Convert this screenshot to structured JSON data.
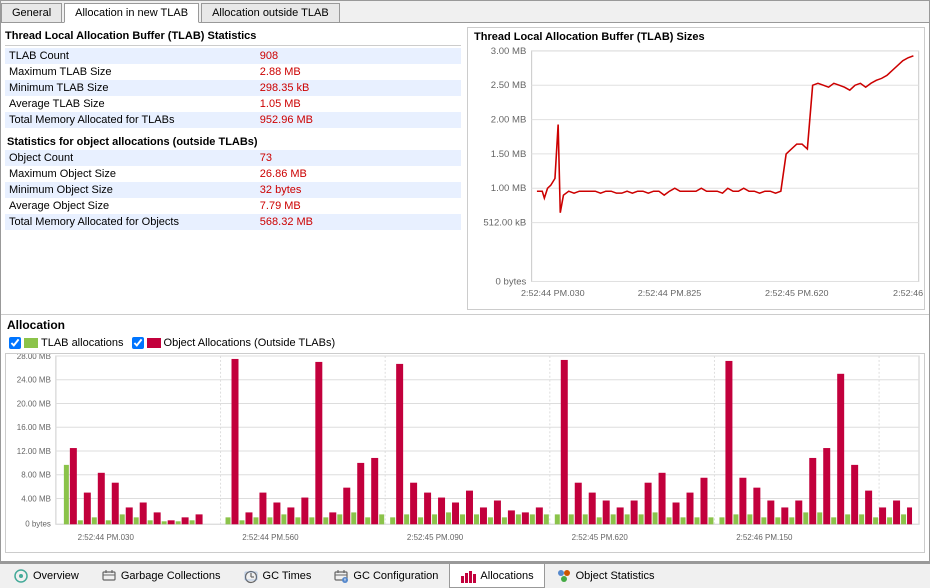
{
  "tabs": {
    "top": [
      {
        "label": "General",
        "active": false
      },
      {
        "label": "Allocation in new TLAB",
        "active": true
      },
      {
        "label": "Allocation outside TLAB",
        "active": false
      }
    ],
    "bottom": [
      {
        "label": "Overview",
        "icon": "overview",
        "active": false
      },
      {
        "label": "Garbage Collections",
        "icon": "gc",
        "active": false
      },
      {
        "label": "GC Times",
        "icon": "gctimes",
        "active": false
      },
      {
        "label": "GC Configuration",
        "icon": "gcconfig",
        "active": false
      },
      {
        "label": "Allocations",
        "icon": "alloc",
        "active": true
      },
      {
        "label": "Object Statistics",
        "icon": "objstats",
        "active": false
      }
    ]
  },
  "tlab_stats": {
    "title": "Thread Local Allocation Buffer (TLAB) Statistics",
    "rows": [
      {
        "label": "TLAB Count",
        "value": "908"
      },
      {
        "label": "Maximum TLAB Size",
        "value": "2.88 MB"
      },
      {
        "label": "Minimum TLAB Size",
        "value": "298.35 kB"
      },
      {
        "label": "Average TLAB Size",
        "value": "1.05 MB"
      },
      {
        "label": "Total Memory Allocated for TLABs",
        "value": "952.96 MB"
      }
    ]
  },
  "outside_stats": {
    "title": "Statistics for object allocations (outside TLABs)",
    "rows": [
      {
        "label": "Object Count",
        "value": "73"
      },
      {
        "label": "Maximum Object Size",
        "value": "26.86 MB"
      },
      {
        "label": "Minimum Object Size",
        "value": "32 bytes"
      },
      {
        "label": "Average Object Size",
        "value": "7.79 MB"
      },
      {
        "label": "Total Memory Allocated for Objects",
        "value": "568.32 MB"
      }
    ]
  },
  "tlab_chart": {
    "title": "Thread Local Allocation Buffer (TLAB) Sizes",
    "y_labels": [
      "3.00 MB",
      "2.50 MB",
      "2.00 MB",
      "1.50 MB",
      "1.00 MB",
      "512.00 kB",
      "0 bytes"
    ],
    "x_labels": [
      "2:52:44 PM.030",
      "2:52:44 PM.825",
      "2:52:45 PM.620",
      "2:52:46"
    ]
  },
  "allocation_section": {
    "title": "Allocation",
    "legend": [
      {
        "label": "TLAB allocations",
        "color": "#8bc34a"
      },
      {
        "label": "Object Allocations (Outside TLABs)",
        "color": "#c2003c"
      }
    ],
    "y_labels": [
      "28.00 MB",
      "24.00 MB",
      "20.00 MB",
      "16.00 MB",
      "12.00 MB",
      "8.00 MB",
      "4.00 MB",
      "0 bytes"
    ],
    "x_labels": [
      "2:52:44 PM.030",
      "2:52:44 PM.560",
      "2:52:45 PM.090",
      "2:52:45 PM.620",
      "2:52:46 PM.150"
    ]
  }
}
